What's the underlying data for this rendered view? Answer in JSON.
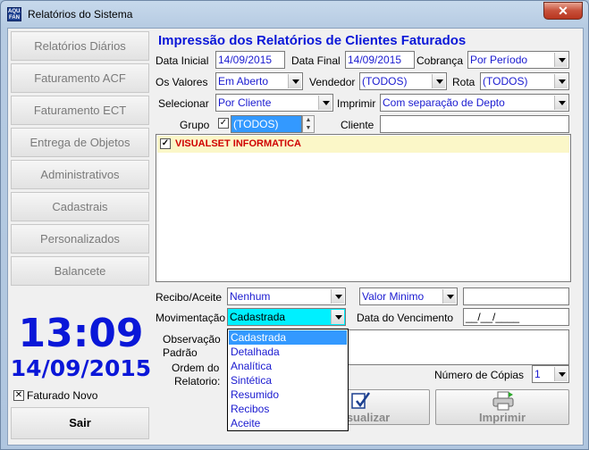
{
  "window": {
    "icon_text": "AQUA FAN",
    "title": "Relatórios do Sistema",
    "close_label": "✕"
  },
  "sidebar": {
    "items": [
      {
        "label": "Relatórios Diários"
      },
      {
        "label": "Faturamento ACF"
      },
      {
        "label": "Faturamento ECT"
      },
      {
        "label": "Entrega de Objetos"
      },
      {
        "label": "Administrativos"
      },
      {
        "label": "Cadastrais"
      },
      {
        "label": "Personalizados"
      },
      {
        "label": "Balancete"
      }
    ],
    "clock_time": "13:09",
    "clock_date": "14/09/2015",
    "faturado_novo_label": "Faturado Novo",
    "faturado_novo_checked": "✕",
    "exit_label": "Sair"
  },
  "form": {
    "title": "Impressão dos Relatórios de Clientes Faturados",
    "data_inicial_label": "Data Inicial",
    "data_inicial_value": "14/09/2015",
    "data_final_label": "Data Final",
    "data_final_value": "14/09/2015",
    "cobranca_label": "Cobrança",
    "cobranca_value": "Por Período",
    "os_valores_label": "Os Valores",
    "os_valores_value": "Em Aberto",
    "vendedor_label": "Vendedor",
    "vendedor_value": "(TODOS)",
    "rota_label": "Rota",
    "rota_value": "(TODOS)",
    "selecionar_label": "Selecionar",
    "selecionar_value": "Por Cliente",
    "imprimir_label": "Imprimir",
    "imprimir_value": "Com separação de Depto",
    "grupo_label": "Grupo",
    "grupo_checked": "✓",
    "grupo_value": "(TODOS)",
    "cliente_label": "Cliente",
    "cliente_value": "",
    "client_list": [
      {
        "name": "VISUALSET INFORMATICA",
        "checked": "✓"
      }
    ],
    "recibo_label": "Recibo/Aceite",
    "recibo_value": "Nenhum",
    "valor_minimo_value": "Valor Minimo",
    "valor_field": "",
    "movimentacao_label": "Movimentação",
    "movimentacao_value": "Cadastrada",
    "vencimento_label": "Data do Vencimento",
    "vencimento_value": "__/__/____",
    "observacao_label": "Observação",
    "padrao_label": "Padrão",
    "ordem_label": "Ordem do",
    "relatorio_label": "Relatorio:",
    "copias_label": "Número de Cópias",
    "copias_value": "1",
    "visualizar_label": "Visualizar",
    "imprimir_btn_label": "Imprimir"
  },
  "dropdown": {
    "options": [
      "Cadastrada",
      "Detalhada",
      "Analítica",
      "Sintética",
      "Resumido",
      "Recibos",
      "Aceite"
    ],
    "selected": "Cadastrada"
  },
  "colors": {
    "accent": "#0a17d8",
    "selection": "#3399ff",
    "highlight_cyan": "#00f0ff",
    "list_row_bg": "#fbf7c8",
    "list_row_text": "#d00000"
  }
}
